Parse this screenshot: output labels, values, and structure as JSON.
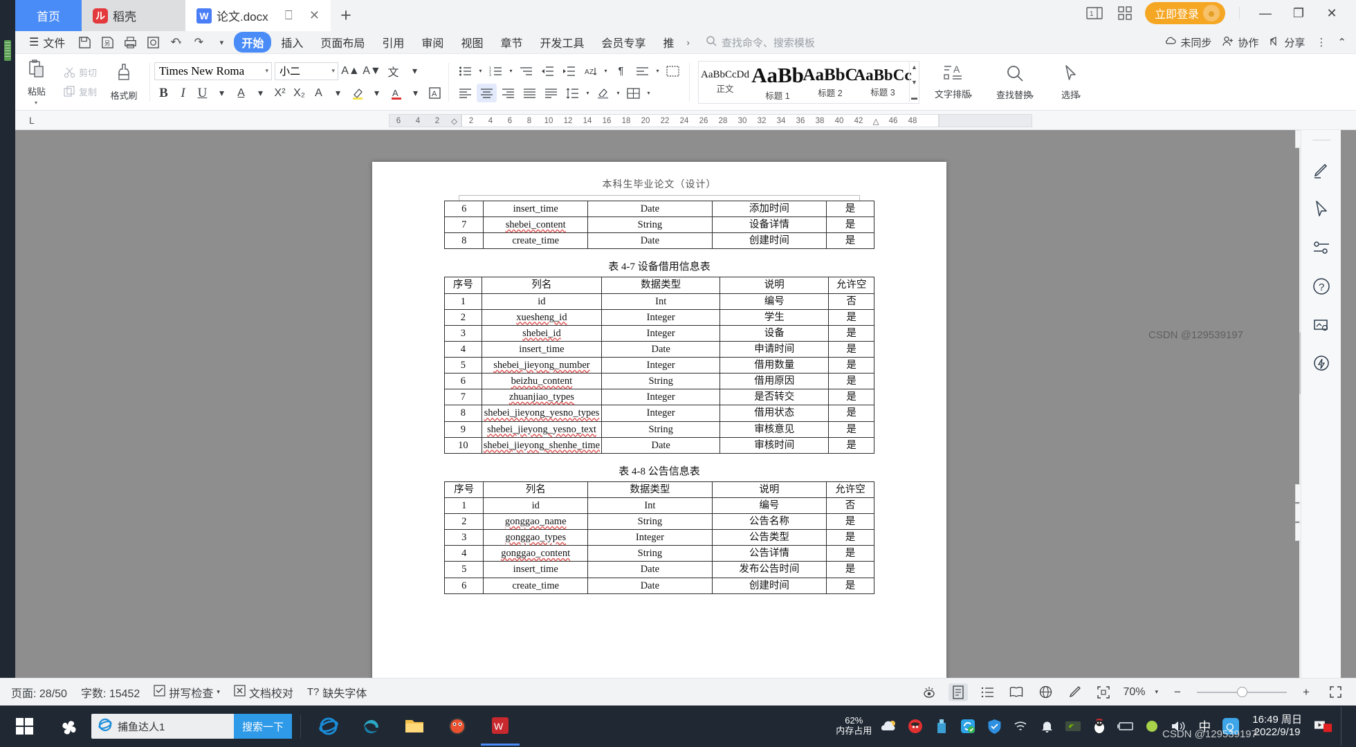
{
  "window": {
    "tabs": [
      {
        "label": "首页",
        "icon": "home-tab"
      },
      {
        "label": "稻壳",
        "icon": "daoke-logo"
      },
      {
        "label": "论文.docx",
        "icon": "word-doc-icon"
      }
    ],
    "new_tab": "+",
    "login_label": "立即登录",
    "minimize": "—",
    "restore": "❐",
    "close": "✕"
  },
  "menu": {
    "file_label": "文件",
    "quick_icons": [
      "save-icon",
      "save-as-icon",
      "print-icon",
      "print-preview-icon",
      "undo-icon",
      "redo-icon",
      "customize-icon"
    ],
    "tabs": [
      {
        "label": "开始",
        "active": true
      },
      {
        "label": "插入",
        "active": false
      },
      {
        "label": "页面布局",
        "active": false
      },
      {
        "label": "引用",
        "active": false
      },
      {
        "label": "审阅",
        "active": false
      },
      {
        "label": "视图",
        "active": false
      },
      {
        "label": "章节",
        "active": false
      },
      {
        "label": "开发工具",
        "active": false
      },
      {
        "label": "会员专享",
        "active": false
      },
      {
        "label": "推",
        "active": false
      }
    ],
    "more": "›",
    "search_placeholder": "查找命令、搜索模板",
    "right_items": [
      {
        "label": "未同步",
        "icon": "cloud-sync-icon"
      },
      {
        "label": "协作",
        "icon": "collaborate-icon"
      },
      {
        "label": "分享",
        "icon": "share-icon"
      }
    ],
    "overflow": "⋮",
    "collapse": "⌃"
  },
  "ribbon": {
    "paste_label": "粘贴",
    "cut_label": "剪切",
    "copy_label": "复制",
    "format_painter_label": "格式刷",
    "font_name": "Times New Roma",
    "font_size": "小二",
    "style_gallery": [
      {
        "preview": "AaBbCcDd",
        "name": "正文",
        "size": "15px"
      },
      {
        "preview": "AaBb",
        "name": "标题 1",
        "size": "31px"
      },
      {
        "preview": "AaBbC",
        "name": "标题 2",
        "size": "25px"
      },
      {
        "preview": "AaBbCc",
        "name": "标题 3",
        "size": "23px"
      }
    ],
    "text_layout_label": "文字排版",
    "find_replace_label": "查找替换",
    "select_label": "选择"
  },
  "ruler": {
    "ticks": [
      "6",
      "4",
      "2",
      "",
      "2",
      "4",
      "6",
      "8",
      "10",
      "12",
      "14",
      "16",
      "18",
      "20",
      "22",
      "24",
      "26",
      "28",
      "30",
      "32",
      "34",
      "36",
      "38",
      "40",
      "42",
      "",
      "46",
      "48"
    ],
    "corner": "L"
  },
  "document": {
    "header_text": "本科生毕业论文（设计）",
    "columns": [
      "序号",
      "列名",
      "数据类型",
      "说明",
      "允许空"
    ],
    "table_prev_rows": [
      [
        "6",
        "insert_time",
        "Date",
        "添加时间",
        "是"
      ],
      [
        "7",
        "shebei_content",
        "String",
        "设备详情",
        "是"
      ],
      [
        "8",
        "create_time",
        "Date",
        "创建时间",
        "是"
      ]
    ],
    "table_47": {
      "caption": "表 4-7 设备借用信息表",
      "rows": [
        [
          "1",
          "id",
          "Int",
          "编号",
          "否"
        ],
        [
          "2",
          "xuesheng_id",
          "Integer",
          "学生",
          "是"
        ],
        [
          "3",
          "shebei_id",
          "Integer",
          "设备",
          "是"
        ],
        [
          "4",
          "insert_time",
          "Date",
          "申请时间",
          "是"
        ],
        [
          "5",
          "shebei_jieyong_number",
          "Integer",
          "借用数量",
          "是"
        ],
        [
          "6",
          "beizhu_content",
          "String",
          "借用原因",
          "是"
        ],
        [
          "7",
          "zhuanjiao_types",
          "Integer",
          "是否转交",
          "是"
        ],
        [
          "8",
          "shebei_jieyong_yesno_types",
          "Integer",
          "借用状态",
          "是"
        ],
        [
          "9",
          "shebei_jieyong_yesno_text",
          "String",
          "审核意见",
          "是"
        ],
        [
          "10",
          "shebei_jieyong_shenhe_time",
          "Date",
          "审核时间",
          "是"
        ]
      ]
    },
    "table_48": {
      "caption": "表 4-8 公告信息表",
      "rows": [
        [
          "1",
          "id",
          "Int",
          "编号",
          "否"
        ],
        [
          "2",
          "gonggao_name",
          "String",
          "公告名称",
          "是"
        ],
        [
          "3",
          "gonggao_types",
          "Integer",
          "公告类型",
          "是"
        ],
        [
          "4",
          "gonggao_content",
          "String",
          "公告详情",
          "是"
        ],
        [
          "5",
          "insert_time",
          "Date",
          "发布公告时间",
          "是"
        ],
        [
          "6",
          "create_time",
          "Date",
          "创建时间",
          "是"
        ]
      ]
    }
  },
  "rail": {
    "icons": [
      "pen-edit-icon",
      "cursor-select-icon",
      "sliders-icon",
      "help-circle-icon",
      "image-tools-icon",
      "ai-spark-icon"
    ]
  },
  "status": {
    "page_label": "页面: 28/50",
    "word_count_label": "字数: 15452",
    "spellcheck_label": "拼写检查",
    "proofread_label": "文档校对",
    "missing_font_label": "缺失字体",
    "zoom_label": "70%",
    "zoom_minus": "−",
    "zoom_plus": "+",
    "view_icons": [
      "eye-preview-icon",
      "page-view-icon",
      "outline-view-icon",
      "book-view-icon",
      "web-view-icon",
      "highlight-icon",
      "fit-page-icon",
      "fullscreen-icon"
    ]
  },
  "taskbar": {
    "start_icon": "windows-start-icon",
    "app_icon": "pinwheel-icon",
    "search_value": "捕鱼达人1",
    "search_button": "搜索一下",
    "browser_icon": "ie-icon",
    "pinned": [
      "ie-icon",
      "edge-icon",
      "folder-icon",
      "firefox-alt-icon",
      "wps-icon"
    ],
    "memory_percent": "62%",
    "memory_label": "内存占用",
    "tray_icons": [
      "weather-icon",
      "security-icon",
      "usb-icon",
      "sync-icon",
      "shield-icon",
      "wifi-icon",
      "bell-icon",
      "nvidia-icon",
      "qq-penguin-icon",
      "battery-icon",
      "volume-icon",
      "ime-icon",
      "qq-icon"
    ],
    "ime_label": "中",
    "clock_time": "16:49 周日",
    "clock_date": "2022/9/19",
    "watermark": "CSDN @129539197"
  }
}
